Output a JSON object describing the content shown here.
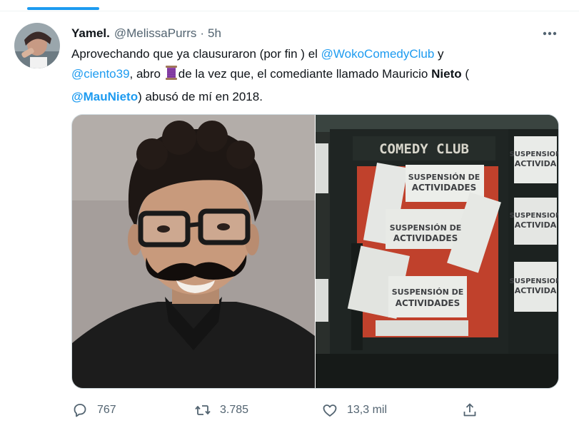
{
  "tweet": {
    "author": {
      "display_name": "Yamel.",
      "handle": "@MelissaPurrs",
      "separator": "·",
      "time": "5h"
    },
    "text": {
      "line1_start": "Aprovechando que ya clausuraron (por fin ) el ",
      "mention_woko": "@WokoComedyClub",
      "line1_end": " y",
      "mention_ciento": "@ciento39",
      "line2_mid_a": ", abro ",
      "line2_mid_b": "de la vez que, el comediante llamado Mauricio ",
      "bold_name": "Nieto",
      "line2_end": " (",
      "mention_mau": "@MauNieto",
      "line3_end": ") abusó de mí en 2018."
    },
    "media": {
      "sign_text": "COMEDY CLUB",
      "seal_big": [
        "SUSPENSIÓN DE",
        "ACTIVIDADES"
      ],
      "seal_small": [
        "SUSPENSION",
        "ACTIVIDA"
      ]
    },
    "actions": {
      "reply_count": "767",
      "retweet_count": "3.785",
      "like_count": "13,3 mil"
    },
    "icons": {
      "reply": "reply-icon",
      "retweet": "retweet-icon",
      "like": "heart-icon",
      "share": "share-icon",
      "more": "more-icon",
      "thread": "thread-spool-icon"
    },
    "colors": {
      "accent": "#1d9bf0",
      "text": "#0f1419",
      "secondary": "#536471",
      "border": "#cfd9de"
    }
  }
}
